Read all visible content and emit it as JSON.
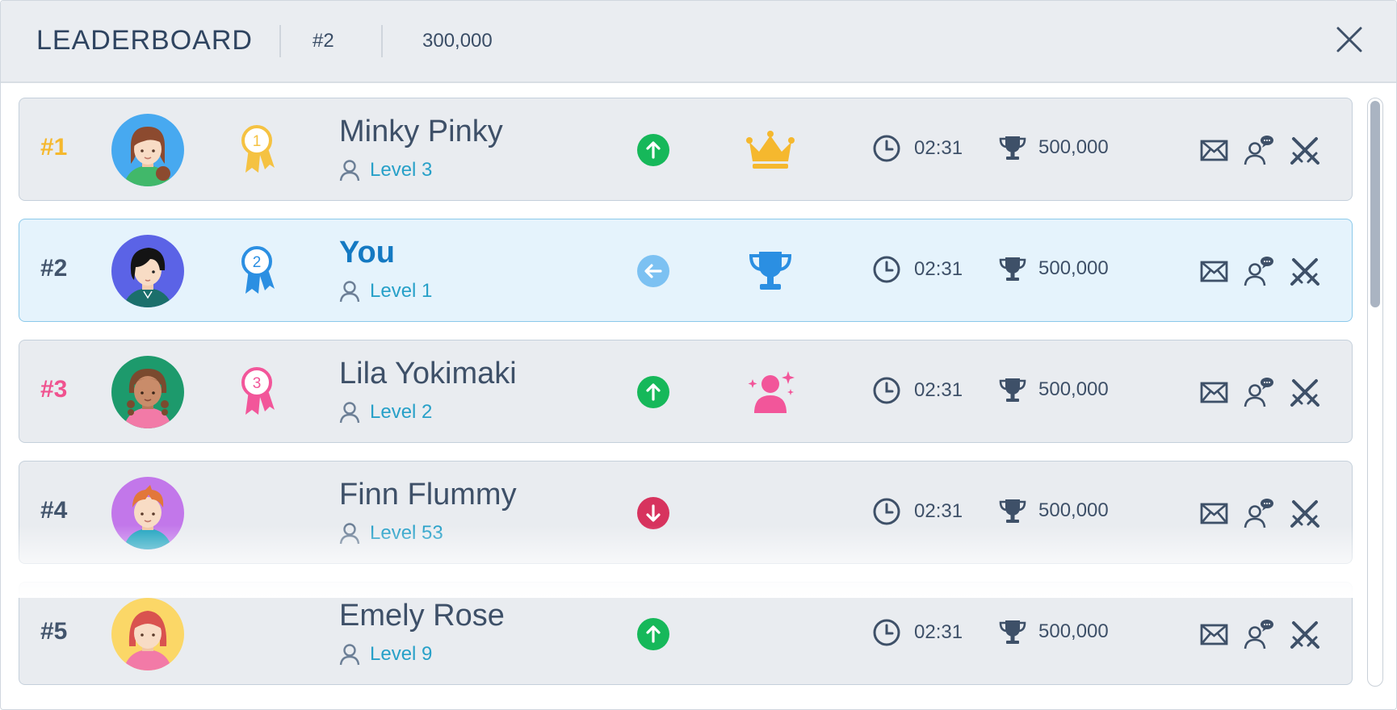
{
  "header": {
    "title": "LEADERBOARD",
    "my_rank": "#2",
    "my_score": "300,000"
  },
  "players": [
    {
      "rank": "#1",
      "rank_color": "#f5b82e",
      "name": "Minky Pinky",
      "level": "Level 3",
      "time": "02:31",
      "score": "500,000",
      "medal": "1",
      "medal_color": "#f5c242",
      "trend": "up",
      "badge": "crown-icon",
      "avatar_bg": "#47a9f0"
    },
    {
      "rank": "#2",
      "rank_color": "#42546c",
      "name": "You",
      "level": "Level 1",
      "time": "02:31",
      "score": "500,000",
      "medal": "2",
      "medal_color": "#2b8fe2",
      "trend": "same",
      "badge": "trophy-icon",
      "avatar_bg": "#5b63e6",
      "is_me": true
    },
    {
      "rank": "#3",
      "rank_color": "#f0528f",
      "name": "Lila Yokimaki",
      "level": "Level 2",
      "time": "02:31",
      "score": "500,000",
      "medal": "3",
      "medal_color": "#f2569a",
      "trend": "up",
      "badge": "star-user-icon",
      "avatar_bg": "#1d9a6c"
    },
    {
      "rank": "#4",
      "rank_color": "#42546c",
      "name": "Finn Flummy",
      "level": "Level 53",
      "time": "02:31",
      "score": "500,000",
      "trend": "down",
      "avatar_bg": "#c277ea"
    },
    {
      "rank": "#5",
      "rank_color": "#42546c",
      "name": "Emely Rose",
      "level": "Level 9",
      "time": "02:31",
      "score": "500,000",
      "trend": "up",
      "avatar_bg": "#fbd767"
    }
  ],
  "colors": {
    "trend_up": "#16b85a",
    "trend_down": "#d7335e",
    "trend_same": "#7cc1f2",
    "icon": "#3e5068"
  }
}
